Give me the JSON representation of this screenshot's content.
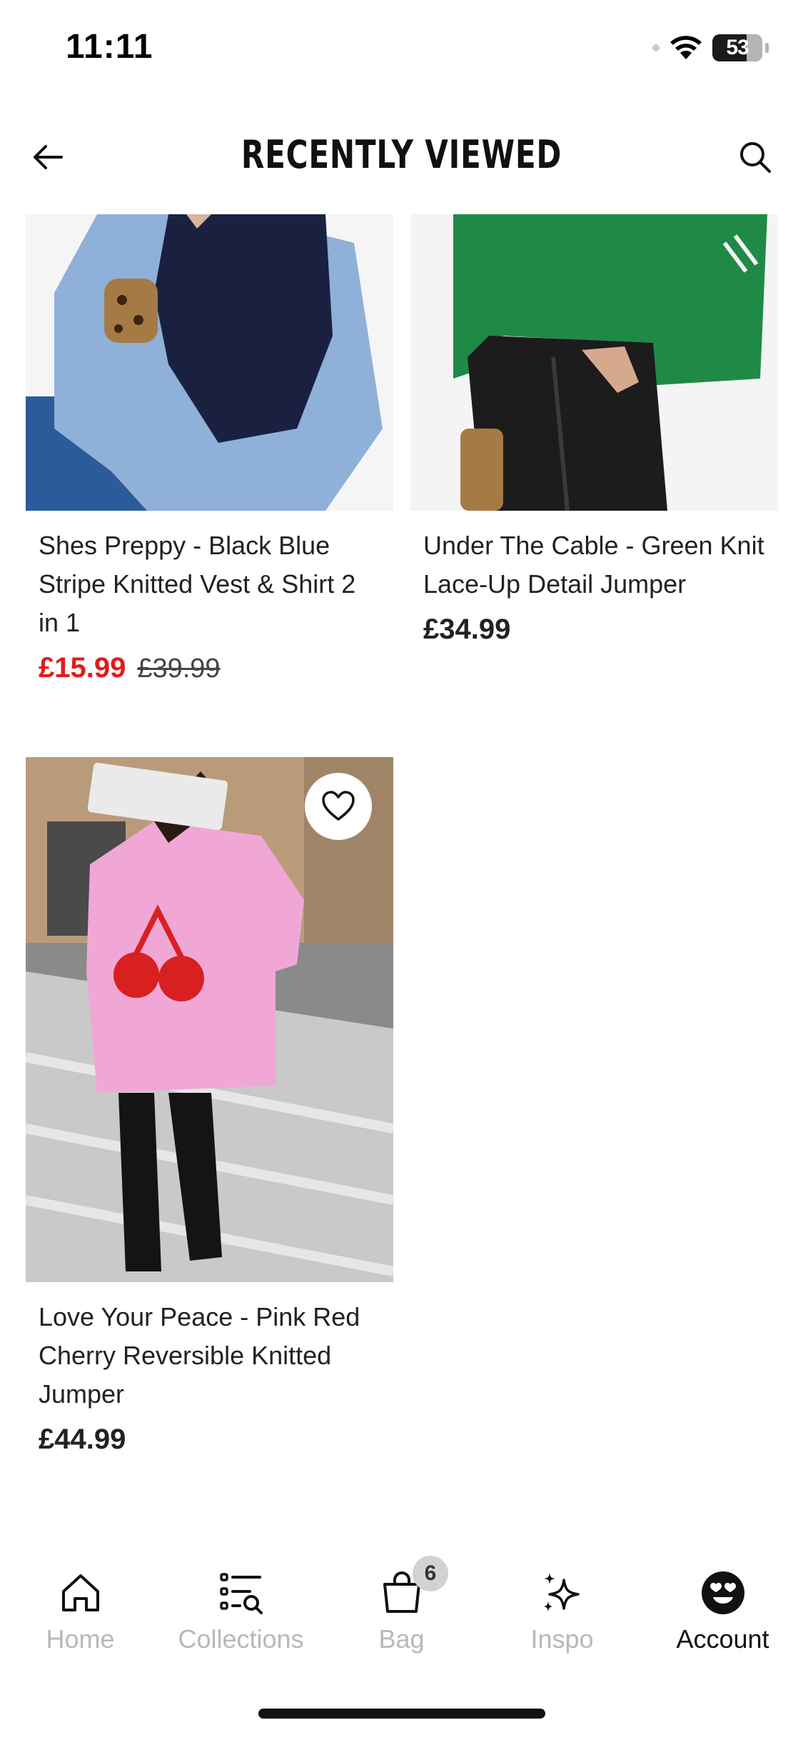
{
  "status_bar": {
    "time": "11:11",
    "battery": "53"
  },
  "header": {
    "title": "RECENTLY VIEWED"
  },
  "products": [
    {
      "title": "Shes Preppy - Black Blue Stripe Knitted Vest & Shirt 2 in 1",
      "price": "£15.99",
      "original_price": "£39.99",
      "on_sale": true
    },
    {
      "title": "Under The Cable - Green Knit Lace-Up Detail Jumper",
      "price": "£34.99",
      "on_sale": false
    },
    {
      "title": "Love Your Peace - Pink Red Cherry Reversible Knitted Jumper",
      "price": "£44.99",
      "on_sale": false
    }
  ],
  "bottom_nav": {
    "items": [
      {
        "label": "Home",
        "icon": "home-icon",
        "active": false
      },
      {
        "label": "Collections",
        "icon": "collections-icon",
        "active": false
      },
      {
        "label": "Bag",
        "icon": "bag-icon",
        "active": false,
        "badge": "6"
      },
      {
        "label": "Inspo",
        "icon": "sparkle-icon",
        "active": false
      },
      {
        "label": "Account",
        "icon": "account-icon",
        "active": true
      }
    ]
  },
  "colors": {
    "sale": "#e11b1b",
    "inactive_nav": "#b8b8b8",
    "active_nav": "#111111"
  }
}
